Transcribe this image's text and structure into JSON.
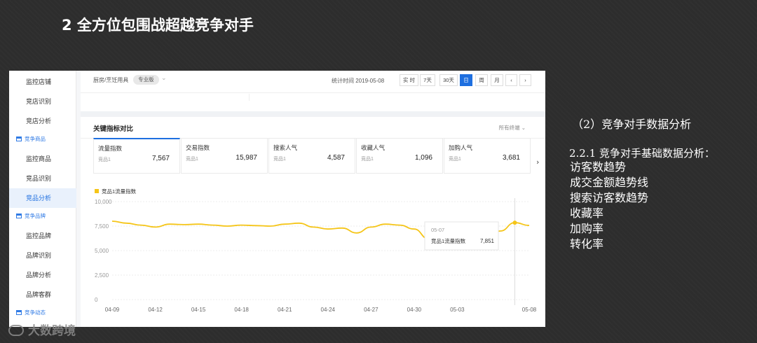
{
  "slide": {
    "title": "2 全方位包围战超越竞争对手",
    "watermark": "大数跨境"
  },
  "sidebar": {
    "items": [
      {
        "label": "监控店铺",
        "type": "item"
      },
      {
        "label": "竞店识别",
        "type": "item"
      },
      {
        "label": "竞店分析",
        "type": "item"
      },
      {
        "label": "竞争商品",
        "type": "group"
      },
      {
        "label": "监控商品",
        "type": "item"
      },
      {
        "label": "竞品识别",
        "type": "item"
      },
      {
        "label": "竞品分析",
        "type": "item",
        "active": true
      },
      {
        "label": "竞争品牌",
        "type": "group"
      },
      {
        "label": "监控品牌",
        "type": "item"
      },
      {
        "label": "品牌识别",
        "type": "item"
      },
      {
        "label": "品牌分析",
        "type": "item"
      },
      {
        "label": "品牌客群",
        "type": "item"
      },
      {
        "label": "竞争动态",
        "type": "group"
      }
    ]
  },
  "topbar": {
    "breadcrumb": "厨房/烹饪用具",
    "pro_tag": "专业版",
    "stat_time": "统计时间 2019-05-08",
    "time_buttons": [
      "实 时",
      "7天",
      "30天",
      "日",
      "周",
      "月",
      "‹",
      "›"
    ],
    "selected_time": "日"
  },
  "card": {
    "title": "关键指标对比",
    "terminal_select": "所有终端",
    "metrics": [
      {
        "name": "流量指数",
        "sub": "竞品1",
        "value": "7,567"
      },
      {
        "name": "交易指数",
        "sub": "竞品1",
        "value": "15,987"
      },
      {
        "name": "搜索人气",
        "sub": "竞品1",
        "value": "4,587"
      },
      {
        "name": "收藏人气",
        "sub": "竞品1",
        "value": "1,096"
      },
      {
        "name": "加购人气",
        "sub": "竞品1",
        "value": "3,681"
      }
    ],
    "next_arrow": "›"
  },
  "chart_data": {
    "type": "line",
    "series": [
      {
        "name": "竞品1流量指数",
        "color": "#f5c518",
        "x": [
          "04-09",
          "04-10",
          "04-11",
          "04-12",
          "04-13",
          "04-14",
          "04-15",
          "04-16",
          "04-17",
          "04-18",
          "04-19",
          "04-20",
          "04-21",
          "04-22",
          "04-23",
          "04-24",
          "04-25",
          "04-26",
          "04-27",
          "04-28",
          "04-29",
          "04-30",
          "05-01",
          "05-02",
          "05-03",
          "05-04",
          "05-05",
          "05-06",
          "05-07",
          "05-08"
        ],
        "values": [
          8000,
          7800,
          7600,
          7400,
          7700,
          7650,
          7700,
          7600,
          7500,
          7600,
          7550,
          7500,
          7700,
          7800,
          7400,
          7200,
          7300,
          6800,
          7400,
          7700,
          7600,
          7200,
          6200,
          5900,
          5950,
          6100,
          6300,
          7000,
          7851,
          7567
        ]
      }
    ],
    "x_ticks": [
      "04-09",
      "04-12",
      "04-15",
      "04-18",
      "04-21",
      "04-24",
      "04-27",
      "04-30",
      "05-03",
      "05-08"
    ],
    "y_ticks": [
      "0",
      "2,500",
      "5,000",
      "7,500",
      "10,000"
    ],
    "ylim": [
      0,
      10000
    ],
    "grid": true,
    "legend": "top-left",
    "tooltip": {
      "date": "05-07",
      "series": "竞品1流量指数",
      "value": "7,851"
    }
  },
  "right_text": {
    "subtitle": "（2）竞争对手数据分析",
    "heading": "2.2.1 竞争对手基础数据分析：",
    "items": [
      "访客数趋势",
      "成交金额趋势线",
      "搜索访客数趋势",
      "收藏率",
      "加购率",
      "转化率"
    ]
  }
}
